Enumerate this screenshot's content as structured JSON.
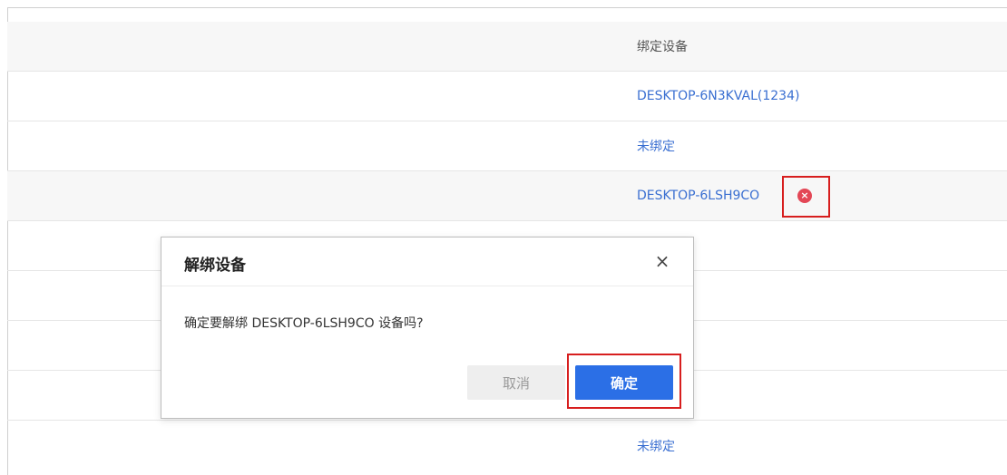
{
  "table": {
    "header": "绑定设备",
    "rows": [
      {
        "device": "DESKTOP-6N3KVAL(1234)"
      },
      {
        "device": "未绑定"
      },
      {
        "device": "DESKTOP-6LSH9CO"
      },
      {
        "device": "未绑定"
      }
    ],
    "unbind_icon": "×"
  },
  "modal": {
    "title": "解绑设备",
    "close": "×",
    "message": "确定要解绑 DESKTOP-6LSH9CO 设备吗?",
    "cancel_label": "取消",
    "confirm_label": "确定"
  },
  "colors": {
    "link": "#3a6fd1",
    "primary": "#2b6fe6",
    "highlight": "#d71e1e",
    "danger": "#e34756"
  }
}
